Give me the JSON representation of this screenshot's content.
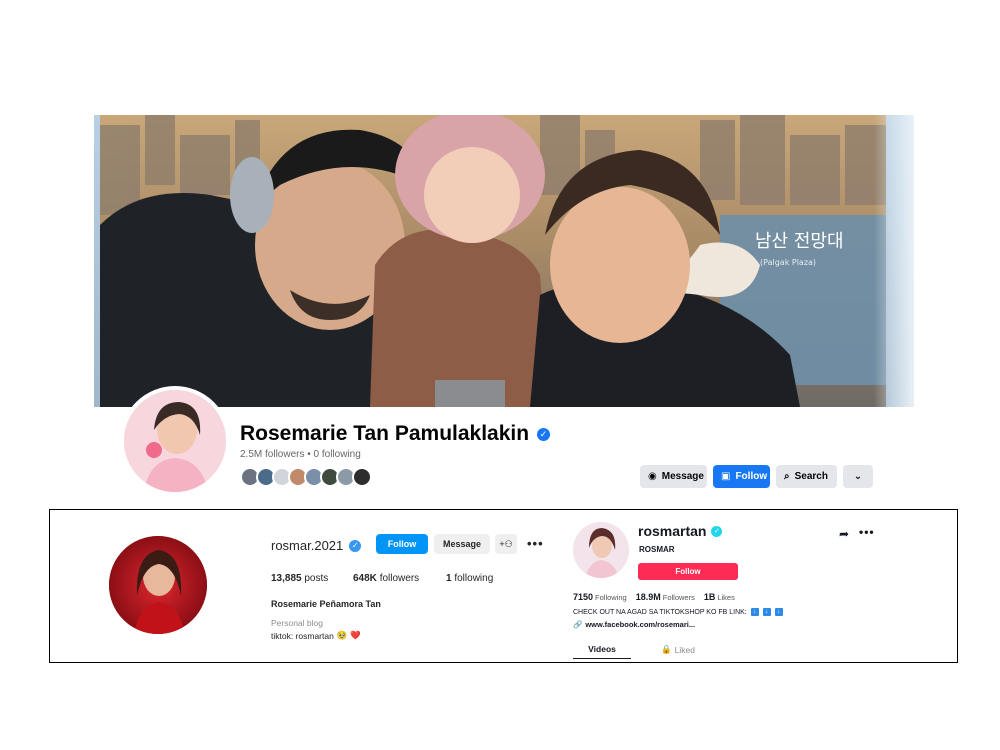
{
  "facebook": {
    "name": "Rosemarie Tan Pamulaklakin",
    "followers": "2.5M followers",
    "following": "0 following",
    "stats_separator": " • ",
    "buttons": {
      "message": "Message",
      "follow": "Follow",
      "search": "Search"
    },
    "cover_sign_text": "남산 전망대",
    "cover_sign_sub": "(Palgak Plaza)",
    "friend_avatars": [
      "#6b7280",
      "#4b6b8a",
      "#d1d5db",
      "#c08a6a",
      "#7b8fa8",
      "#3f4b3f",
      "#8c9aa8",
      "#2d2d2d"
    ]
  },
  "instagram": {
    "username": "rosmar.2021",
    "follow_label": "Follow",
    "message_label": "Message",
    "posts_count": "13,885",
    "posts_label": "posts",
    "followers_count": "648K",
    "followers_label": "followers",
    "following_count": "1",
    "following_label": "following",
    "full_name": "Rosemarie Peñamora Tan",
    "category": "Personal blog",
    "bio": "tiktok: rosmartan",
    "bio_emoji_1": "🥹",
    "bio_emoji_2": "❤️"
  },
  "tiktok": {
    "username": "rosmartan",
    "nickname": "ROSMAR",
    "follow_label": "Follow",
    "following_count": "7150",
    "following_label": "Following",
    "followers_count": "18.9M",
    "followers_label": "Followers",
    "likes_count": "1B",
    "likes_label": "Likes",
    "bio": "CHECK OUT NA AGAD SA TIKTOKSHOP KO FB LINK:",
    "link": "www.facebook.com/rosemari...",
    "tabs": {
      "videos": "Videos",
      "liked": "Liked"
    }
  },
  "colors": {
    "fb_blue": "#1877f2",
    "ig_blue": "#0095f6",
    "tt_red": "#fe2c55",
    "tt_verified": "#20d5ec"
  }
}
